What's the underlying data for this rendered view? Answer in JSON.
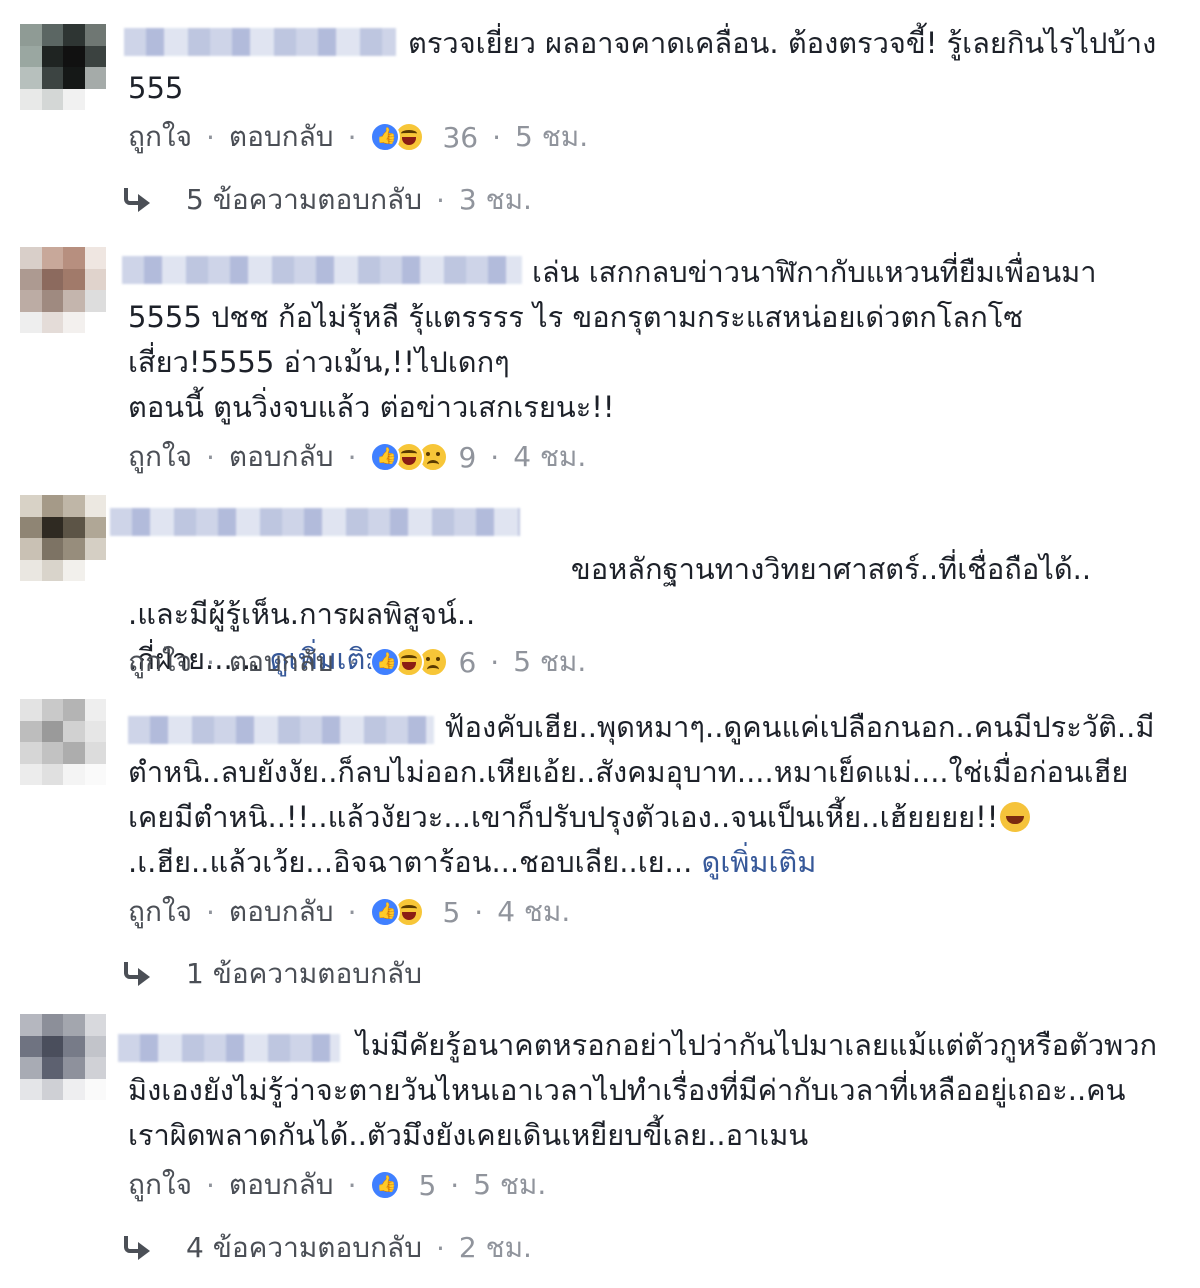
{
  "ui": {
    "like": "ถูกใจ",
    "reply": "ตอบกลับ",
    "see_more": "ดูเพิ่มเติม"
  },
  "comments": [
    {
      "text": "ตรวจเยี่ยว ผลอาจคาดเคลื่อน. ต้องตรวจขี้! รู้เลยกินไรไปบ้าง 555",
      "reaction_count": "36",
      "time": "5 ชม.",
      "reactions": [
        "like-icon",
        "haha-icon"
      ],
      "replies_label": "5 ข้อความตอบกลับ",
      "replies_time": "3 ชม."
    },
    {
      "text": "เล่น เสกกลบข่าวนาฬิกากับแหวนที่ยืมเพื่อนมา 5555 ปชช ก้อไม่รุ้หลี รุ้แตรรรร ไร ขอกรุตามกระแสหน่อยเด่วตกโลกโซเสี่ยว!5555 อ่าวเม้น,!!ไปเดกๆ\nตอนนี้ ตูนวิ่งจบแล้ว ต่อข่าวเสกเรยนะ!!",
      "reaction_count": "9",
      "time": "4 ชม.",
      "reactions": [
        "like-icon",
        "haha-icon",
        "sad-icon"
      ]
    },
    {
      "text": "ขอหลักฐานทางวิทยาศาสตร์..ที่เชื่อถือได้..\n.และมีผู้รู้เห็น.การผลพิสูจน์..\n.กี่ฝ่าย......",
      "reaction_count": "6",
      "time": "5 ชม.",
      "reactions": [
        "like-icon",
        "haha-icon",
        "sad-icon"
      ]
    },
    {
      "text_before": "ฟ้องคับเฮีย..พุดหมาๆ..ดูคนแค่เปลือกนอก..คนมีประวัติ..มีตำหนิ..ลบยังงัย..ก็ลบไม่ออก.เหียเอ้ย..สังคมอุบาท....หมาเย็ดแม่....ใช่เมื่อก่อนเฮียเคยมีตำหนิ..!!..แล้วงัยวะ...เขาก็ปรับปรุงตัวเอง..จนเป็นเหี้ย..เฮ้ยยยย!!",
      "text_after": ".เ.ฮีย..แล้วเว้ย...อิจฉาตาร้อน...ชอบเลีย..เย...",
      "reaction_count": "5",
      "time": "4 ชม.",
      "reactions": [
        "like-icon",
        "haha-icon"
      ],
      "replies_label": "1 ข้อความตอบกลับ"
    },
    {
      "text": "ไม่มีคัยรู้อนาคตหรอกอย่าไปว่ากันไปมาเลยแม้แต่ตัวกูหรือตัวพวกมิงเองยังไม่รู้ว่าจะตายวันไหนเอาเวลาไปทำเรื่องที่มีค่ากับเวลาที่เหลืออยู่เถอะ..คนเราผิดพลาดกันได้..ตัวมึงยังเคยเดินเหยียบขี้เลย..อาเมน",
      "reaction_count": "5",
      "time": "5 ชม.",
      "reactions": [
        "like-icon"
      ],
      "replies_label": "4 ข้อความตอบกลับ",
      "replies_time": "2 ชม."
    }
  ]
}
